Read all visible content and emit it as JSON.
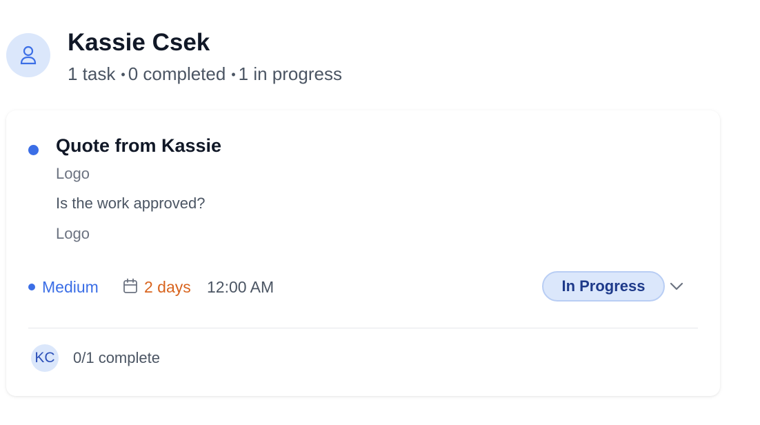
{
  "header": {
    "name": "Kassie Csek",
    "stats": {
      "tasks": "1 task",
      "completed": "0 completed",
      "in_progress": "1 in progress",
      "separator": "•"
    },
    "avatar_icon": "user-icon"
  },
  "task": {
    "title": "Quote from Kassie",
    "lines": [
      "Logo",
      "Is the work approved?",
      "Logo"
    ],
    "priority": "Medium",
    "due": "2 days",
    "time": "12:00 AM",
    "status": "In Progress",
    "assignee_initials": "KC",
    "progress": "0/1 complete"
  },
  "colors": {
    "accent": "#3b6ee6",
    "due_warning": "#d8641e",
    "status_bg": "#dbe7fb",
    "status_text": "#1e3a8a"
  },
  "icons": {
    "calendar": "calendar-icon",
    "chevron": "chevron-down-icon"
  }
}
